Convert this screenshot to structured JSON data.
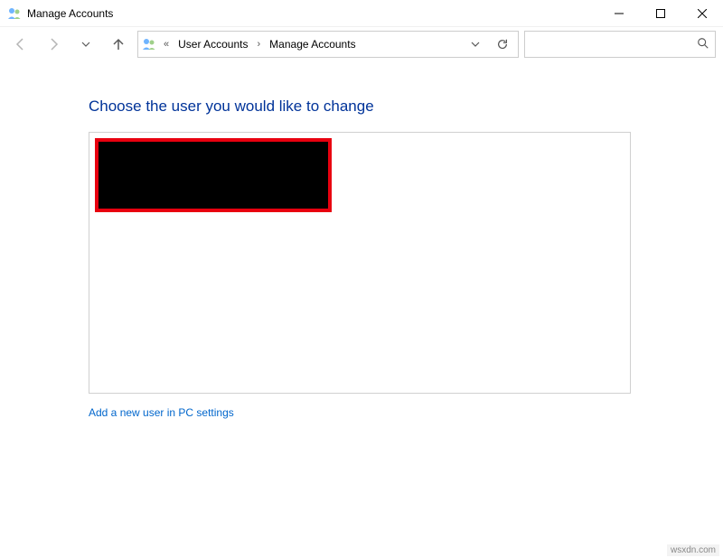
{
  "window": {
    "title": "Manage Accounts"
  },
  "breadcrumb": {
    "root": "User Accounts",
    "current": "Manage Accounts"
  },
  "page": {
    "heading": "Choose the user you would like to change",
    "add_user_link": "Add a new user in PC settings"
  },
  "watermark": "wsxdn.com"
}
